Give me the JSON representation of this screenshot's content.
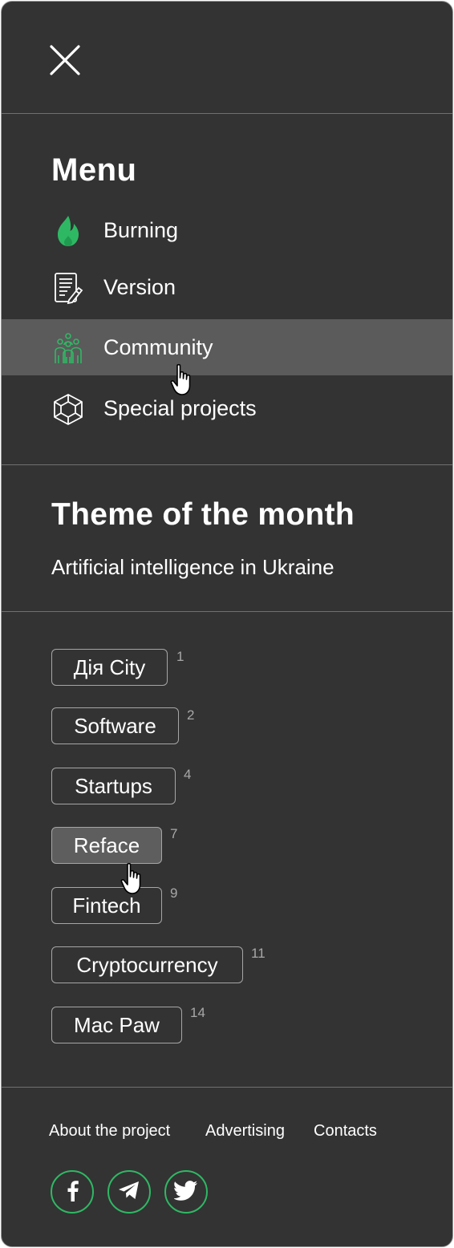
{
  "menu": {
    "title": "Menu",
    "items": [
      {
        "label": "Burning",
        "icon": "flame-icon"
      },
      {
        "label": "Version",
        "icon": "notepad-pencil-icon"
      },
      {
        "label": "Community",
        "icon": "people-group-icon"
      },
      {
        "label": "Special projects",
        "icon": "cube-icon"
      }
    ]
  },
  "theme": {
    "title": "Theme of the month",
    "subtitle": "Artificial intelligence in Ukraine"
  },
  "tags": [
    {
      "label": "Дія City",
      "count": "1"
    },
    {
      "label": "Software",
      "count": "2"
    },
    {
      "label": "Startups",
      "count": "4"
    },
    {
      "label": "Reface",
      "count": "7"
    },
    {
      "label": "Fintech",
      "count": "9"
    },
    {
      "label": "Cryptocurrency",
      "count": "11"
    },
    {
      "label": "Mac Paw",
      "count": "14"
    }
  ],
  "footer": {
    "links": [
      "About the project",
      "Advertising",
      "Contacts"
    ],
    "social": [
      "facebook-icon",
      "telegram-icon",
      "twitter-icon"
    ]
  },
  "colors": {
    "background": "#333333",
    "accent_green": "#2fb864",
    "hover": "#5b5b5b"
  }
}
